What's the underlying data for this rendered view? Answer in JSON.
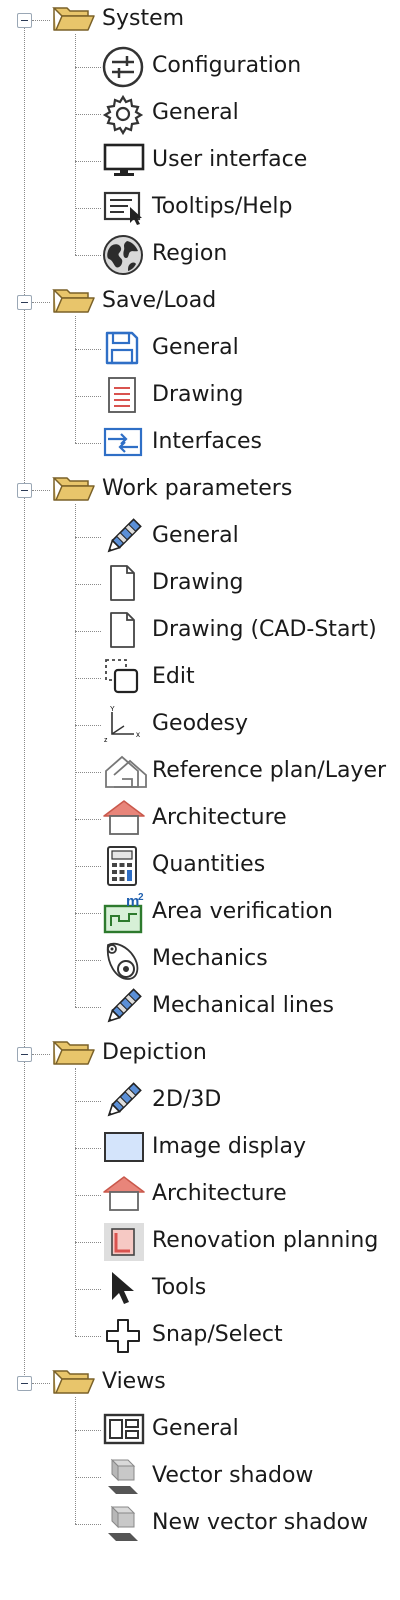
{
  "groups": [
    {
      "label": "System",
      "items": [
        {
          "label": "Configuration",
          "icon": "sliders-icon"
        },
        {
          "label": "General",
          "icon": "gear-icon"
        },
        {
          "label": "User interface",
          "icon": "monitor-icon"
        },
        {
          "label": "Tooltips/Help",
          "icon": "tooltip-icon"
        },
        {
          "label": "Region",
          "icon": "globe-icon"
        }
      ]
    },
    {
      "label": "Save/Load",
      "items": [
        {
          "label": "General",
          "icon": "floppy-disk-icon"
        },
        {
          "label": "Drawing",
          "icon": "drawing-file-icon"
        },
        {
          "label": "Interfaces",
          "icon": "interfaces-icon"
        }
      ]
    },
    {
      "label": "Work parameters",
      "items": [
        {
          "label": "General",
          "icon": "pencil-icon"
        },
        {
          "label": "Drawing",
          "icon": "blank-page-icon"
        },
        {
          "label": "Drawing (CAD-Start)",
          "icon": "blank-page-icon"
        },
        {
          "label": "Edit",
          "icon": "edit-selection-icon"
        },
        {
          "label": "Geodesy",
          "icon": "coordinate-axes-icon"
        },
        {
          "label": "Reference plan/Layer",
          "icon": "reference-plan-icon"
        },
        {
          "label": "Architecture",
          "icon": "house-icon"
        },
        {
          "label": "Quantities",
          "icon": "calculator-icon"
        },
        {
          "label": "Area verification",
          "icon": "area-m2-icon"
        },
        {
          "label": "Mechanics",
          "icon": "mechanics-icon"
        },
        {
          "label": "Mechanical lines",
          "icon": "pencil-icon"
        }
      ]
    },
    {
      "label": "Depiction",
      "items": [
        {
          "label": "2D/3D",
          "icon": "pencil-icon"
        },
        {
          "label": "Image display",
          "icon": "image-display-icon"
        },
        {
          "label": "Architecture",
          "icon": "house-icon"
        },
        {
          "label": "Renovation planning",
          "icon": "renovation-icon"
        },
        {
          "label": "Tools",
          "icon": "cursor-arrow-icon"
        },
        {
          "label": "Snap/Select",
          "icon": "snap-cross-icon"
        }
      ]
    },
    {
      "label": "Views",
      "items": [
        {
          "label": "General",
          "icon": "layout-views-icon"
        },
        {
          "label": "Vector shadow",
          "icon": "shadow-block-icon"
        },
        {
          "label": "New vector shadow",
          "icon": "shadow-block-icon"
        }
      ]
    }
  ],
  "colors": {
    "folder": "#e8c56b",
    "folder_edge": "#7a6128",
    "house_roof": "#e8857a",
    "accent_blue": "#2f6fc6",
    "toggle_border": "#9aa7b5"
  }
}
